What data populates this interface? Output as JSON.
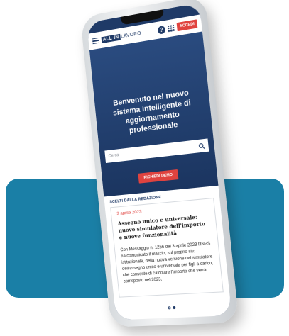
{
  "header": {
    "logo_box": "ALL-IN",
    "logo_text": "LAVORO",
    "help_label": "?",
    "login_label": "ACCEDI"
  },
  "hero": {
    "title": "Benvenuto nel nuovo sistema intelligente di aggiornamento professionale",
    "search_placeholder": "Cerca",
    "demo_label": "RICHIEDI DEMO"
  },
  "section": {
    "label": "SCELTI DALLA REDAZIONE"
  },
  "article": {
    "date": "3 aprile 2023",
    "title": "Assegno unico e universale: nuovo simulatore dell'importo e nuove funzionalità",
    "body": "Con Messaggio n. 1256 del 3 aprile 2023 l'INPS ha comunicato il rilascio, sul proprio sito istituzionale, della nuova versione del simulatore dell'assegno unico e universale per figli a carico, che consente di calcolare l'importo che verrà corrisposto nel 2023,"
  },
  "carousel": {
    "count": 2,
    "active_index": 1
  },
  "colors": {
    "brand_navy": "#1f3a67",
    "accent_red": "#e0433f",
    "backdrop_blue": "#1a7fa6"
  }
}
